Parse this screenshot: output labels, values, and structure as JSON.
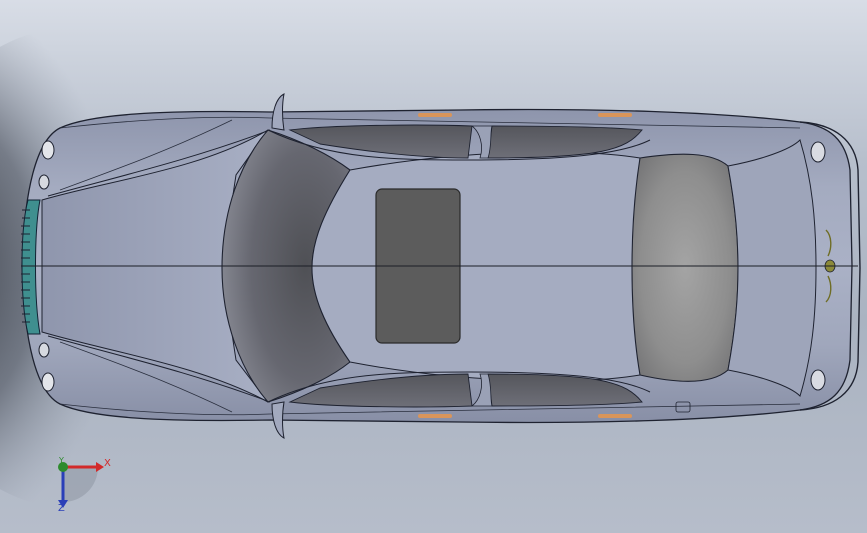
{
  "viewport": {
    "background_top": "#d8dde6",
    "background_bottom": "#aab3c1",
    "body_color": "#9aa1b8",
    "glass_color": "#5f6068",
    "sunroof_color": "#5c5c5c",
    "amber_color": "#d9955a"
  },
  "model": {
    "icon": "car-top-view"
  },
  "triad": {
    "x_label": "X",
    "y_label": "Y",
    "z_label": "Z",
    "x_color": "#d22a2a",
    "y_color": "#2e8b2e",
    "z_color": "#2a3fb8"
  }
}
